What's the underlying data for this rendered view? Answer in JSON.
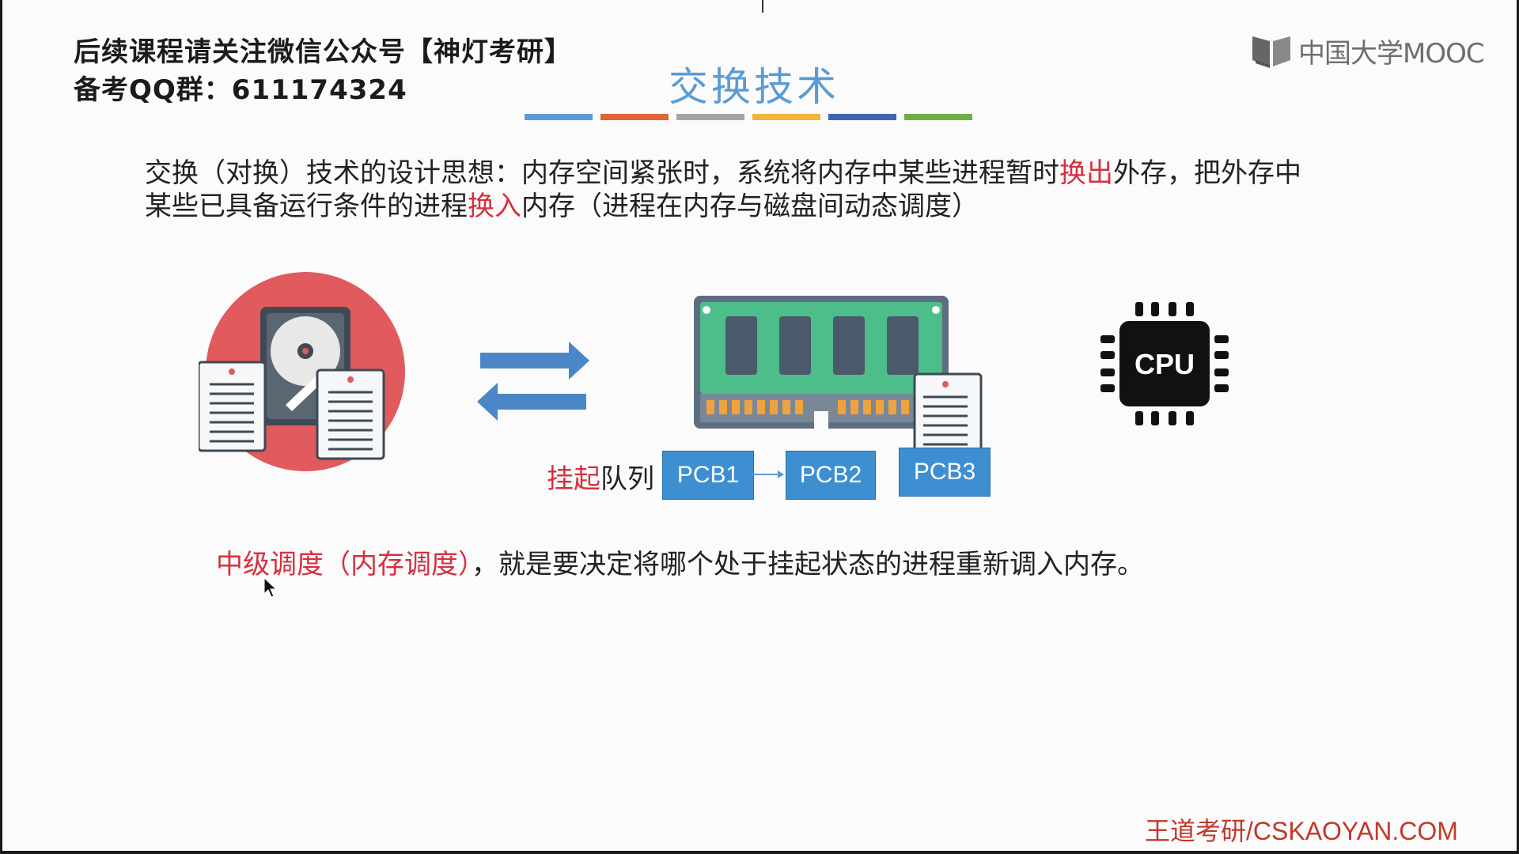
{
  "header": {
    "line1": "后续课程请关注微信公众号【神灯考研】",
    "line2": "备考QQ群：611174324"
  },
  "logo": {
    "text": "中国大学MOOC",
    "icon": "mooc-book-icon"
  },
  "slide": {
    "title": "交换技术",
    "title_bar_colors": [
      "#5b9bd5",
      "#e0643a",
      "#a5a5a5",
      "#f0b43c",
      "#3f64b4",
      "#70ad47"
    ],
    "paragraph": {
      "p1": "交换（对换）技术的设计思想：内存空间紧张时，系统将内存中某些进程暂时",
      "h1": "换出",
      "p2": "外存，把外存中",
      "p3": "某些已具备运行条件的进程",
      "h2": "换入",
      "p4": "内存（进程在内存与磁盘间动态调度）"
    },
    "diagram": {
      "disk_icon": "hard-disk-icon",
      "arrows_icon": "swap-arrows-icon",
      "ram_icon": "memory-module-icon",
      "cpu_label": "CPU",
      "queue_label_highlight": "挂起",
      "queue_label_rest": "队列",
      "pcbs": [
        "PCB1",
        "PCB2",
        "PCB3"
      ]
    },
    "summary": {
      "highlight": "中级调度（内存调度）",
      "rest": "，就是要决定将哪个处于挂起状态的进程重新调入内存。"
    },
    "footer_brand": "王道考研/CSKAOYAN.COM"
  },
  "colors": {
    "accent_blue": "#5b9bd5",
    "highlight_red": "#d63040",
    "pcb_blue": "#3d8fd1",
    "brand_red": "#c0392b"
  }
}
